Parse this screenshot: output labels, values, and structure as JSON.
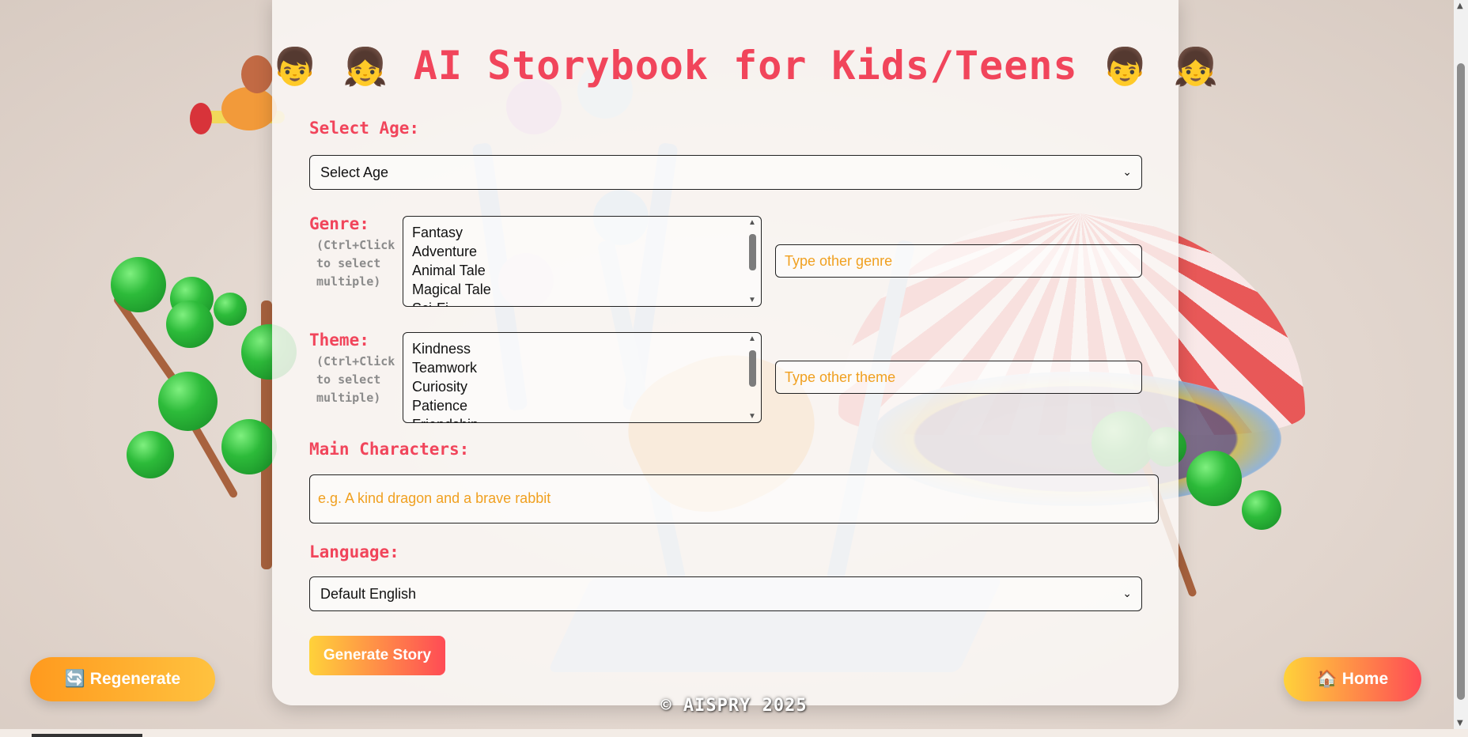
{
  "title": {
    "left_emoji_1": "👦",
    "left_emoji_2": "👧",
    "text": "AI Storybook for Kids/Teens",
    "right_emoji_1": "👦",
    "right_emoji_2": "👧"
  },
  "age": {
    "label": "Select Age:",
    "selected": "Select Age"
  },
  "genre": {
    "label": "Genre:",
    "hint": "(Ctrl+Click to select multiple)",
    "options": [
      "Fantasy",
      "Adventure",
      "Animal Tale",
      "Magical Tale",
      "Sci-Fi"
    ],
    "other_placeholder": "Type other genre"
  },
  "theme": {
    "label": "Theme:",
    "hint": "(Ctrl+Click to select multiple)",
    "options": [
      "Kindness",
      "Teamwork",
      "Curiosity",
      "Patience",
      "Friendship"
    ],
    "other_placeholder": "Type other theme"
  },
  "characters": {
    "label": "Main Characters:",
    "placeholder": "e.g. A kind dragon and a brave rabbit"
  },
  "language": {
    "label": "Language:",
    "selected": "Default English"
  },
  "buttons": {
    "generate": "Generate Story",
    "regenerate": "🔄 Regenerate",
    "home": "🏠 Home"
  },
  "footer": "© AISPRY 2025",
  "colors": {
    "accent": "#f1455b",
    "placeholder": "#f0a020",
    "gradient_start": "#ffd23a",
    "gradient_end": "#ff4b55"
  }
}
